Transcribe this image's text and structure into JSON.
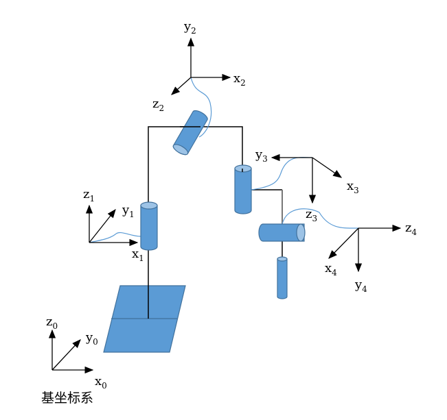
{
  "frames": [
    {
      "axis1": "z",
      "axis2": "y",
      "axis3": "x",
      "sub": "0"
    },
    {
      "axis1": "z",
      "axis2": "y",
      "axis3": "x",
      "sub": "1"
    },
    {
      "axis1": "y",
      "axis2": "x",
      "axis3": "z",
      "sub": "2"
    },
    {
      "axis1": "y",
      "axis2": "x",
      "axis3": "z",
      "sub": "3"
    },
    {
      "axis1": "z",
      "axis2": "x",
      "axis3": "y",
      "sub": "4"
    }
  ],
  "base_label": "基坐标系",
  "colors": {
    "link": "#5b9bd5",
    "cap": "#9dc3e6",
    "edge": "#41719c"
  }
}
